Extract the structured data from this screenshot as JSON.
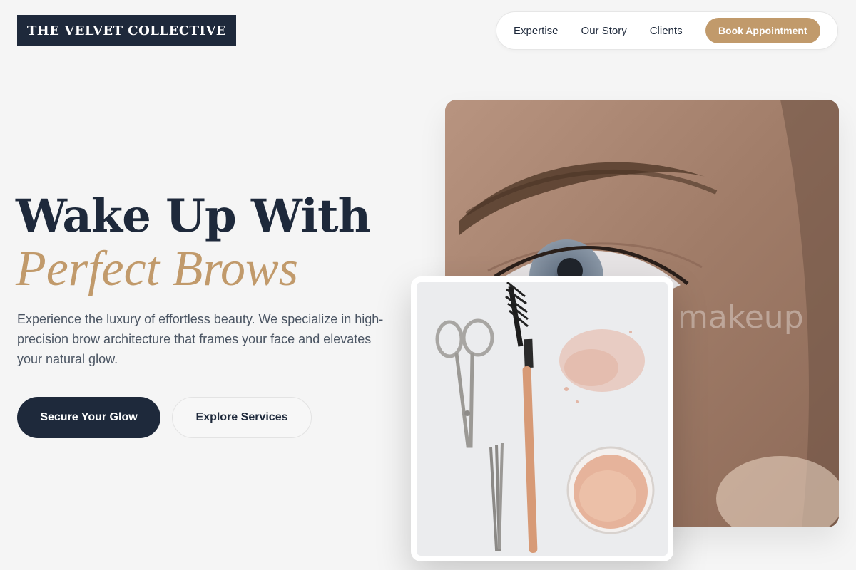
{
  "brand": {
    "name": "THE VELVET COLLECTIVE"
  },
  "nav": {
    "links": [
      "Expertise",
      "Our Story",
      "Clients"
    ],
    "cta": "Book Appointment"
  },
  "hero": {
    "headline_line1": "Wake Up With",
    "headline_line2": "Perfect Brows",
    "subtext": "Experience the luxury of effortless beauty. We specialize in high-precision brow architecture that frames your face and elevates your natural glow.",
    "primary_button": "Secure Your Glow",
    "secondary_button": "Explore Services"
  },
  "images": {
    "main_watermark": "makeup"
  },
  "colors": {
    "navy": "#1e293b",
    "gold": "#c19a6b",
    "background": "#f5f5f5"
  }
}
